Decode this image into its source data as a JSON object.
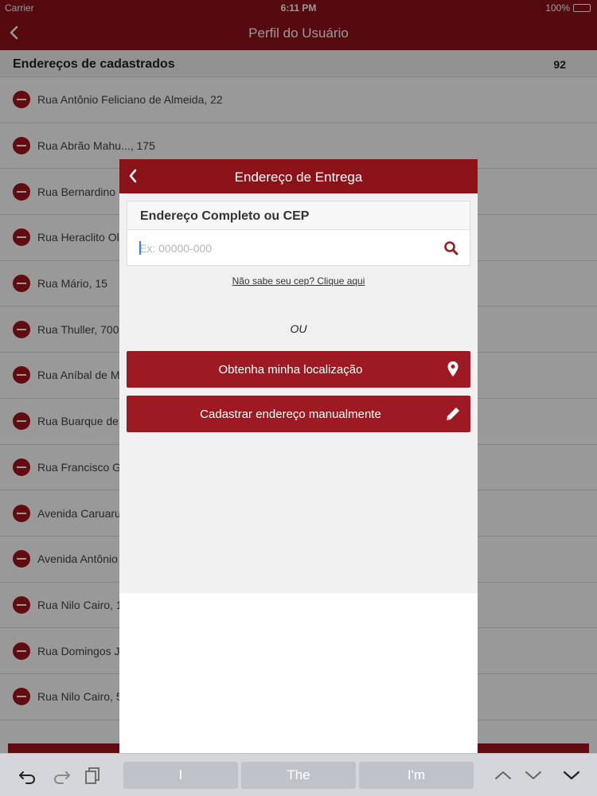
{
  "status_bar": {
    "carrier": "Carrier",
    "time": "6:11 PM",
    "battery": "100%"
  },
  "nav": {
    "title": "Perfil do Usuário"
  },
  "section": {
    "label": "Endereços de cadastrados",
    "count": "92"
  },
  "addresses": [
    "Rua Antônio Feliciano de Almeida, 22",
    "Rua Abrão Mahu..., 175",
    "Rua Bernardino",
    "Rua Heraclito Ol",
    "Rua Mário, 15",
    "Rua Thuller, 700",
    "Rua Aníbal de M",
    "Rua Buarque de",
    "Rua Francisco G",
    "Avenida Caruaru",
    "Avenida Antônio",
    "Rua Nilo Cairo, 1",
    "Rua Domingos J",
    "Rua Nilo Cairo, 5"
  ],
  "modal": {
    "title": "Endereço de Entrega",
    "field_label": "Endereço Completo ou CEP",
    "field_value": "",
    "field_placeholder": "Ex: 00000-000",
    "cep_link": "Não sabe seu cep? Clique aqui",
    "or_text": "OU",
    "location_button": "Obtenha minha localização",
    "manual_button": "Cadastrar endereço manualmente"
  },
  "keyboard": {
    "suggestions": [
      "I",
      "The",
      "I'm"
    ]
  },
  "colors": {
    "brand": "#8c1219",
    "button": "#9e1a22",
    "caret": "#2f7cf6"
  }
}
